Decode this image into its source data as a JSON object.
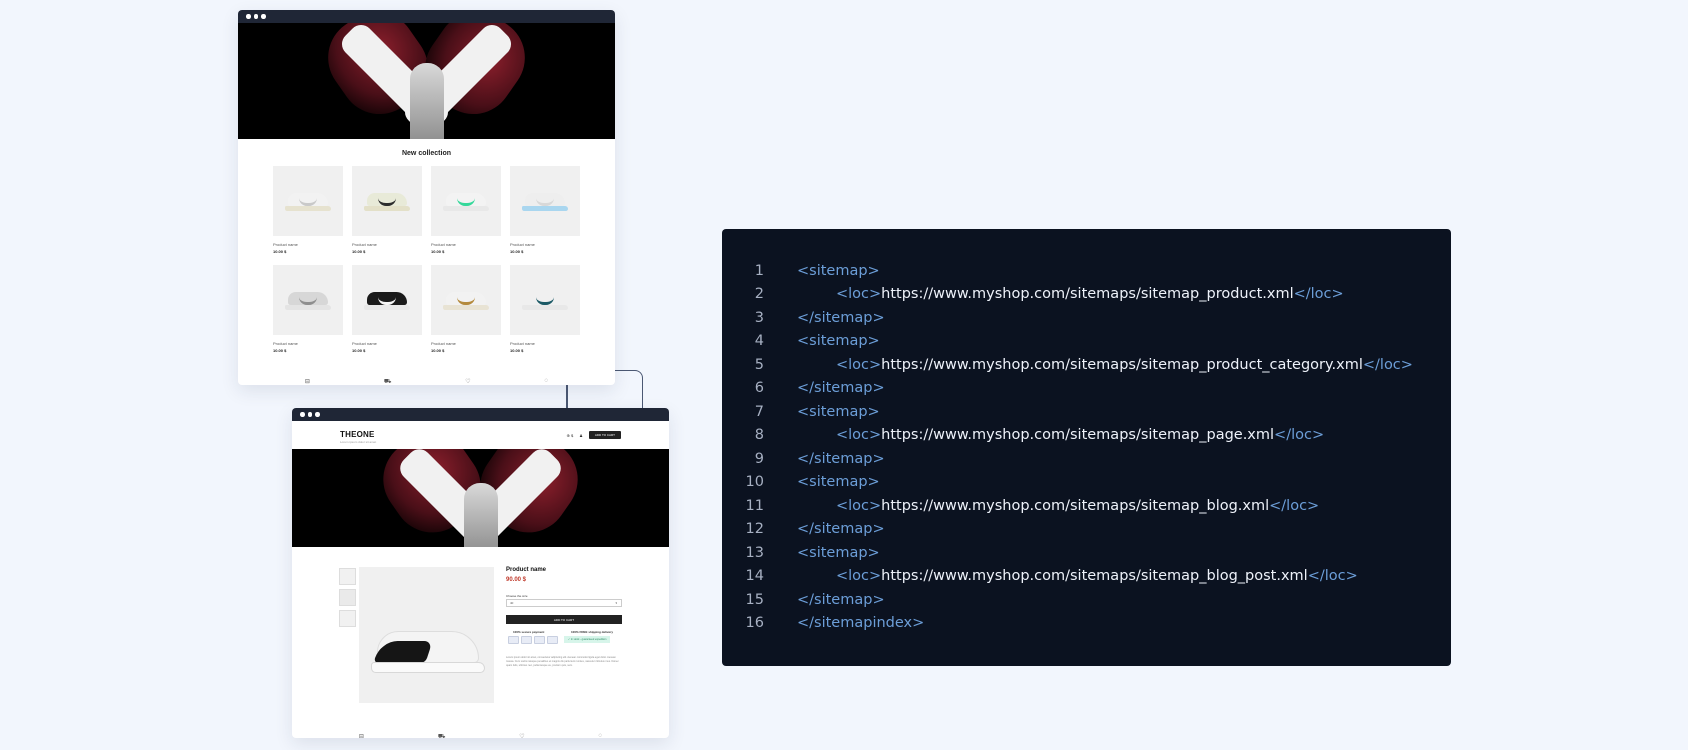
{
  "window1": {
    "section_title": "New collection",
    "products": [
      {
        "name": "Product name",
        "price": "10.00 $",
        "upper": "#f2f2f2",
        "swoosh": "#c9c9c9",
        "sole": "#e6e2cf"
      },
      {
        "name": "Product name",
        "price": "10.00 $",
        "upper": "#e8ead8",
        "swoosh": "#2c2c2c",
        "sole": "#e3e0c8"
      },
      {
        "name": "Product name",
        "price": "10.00 $",
        "upper": "#f3f3f3",
        "swoosh": "#35d89a",
        "sole": "#e8e8e8"
      },
      {
        "name": "Product name",
        "price": "10.00 $",
        "upper": "#eeeeee",
        "swoosh": "#d8d8d8",
        "sole": "#a9d6ef"
      },
      {
        "name": "Product name",
        "price": "10.00 $",
        "upper": "#d7d7d7",
        "swoosh": "#8e8e8e",
        "sole": "#e4e4e4"
      },
      {
        "name": "Product name",
        "price": "10.00 $",
        "upper": "#1a1a1a",
        "swoosh": "#f4f4f4",
        "sole": "#e8e8e8"
      },
      {
        "name": "Product name",
        "price": "10.00 $",
        "upper": "#f2f2f2",
        "swoosh": "#b48a3c",
        "sole": "#e8e3d4"
      },
      {
        "name": "Product name",
        "price": "10.00 $",
        "upper": "#f0f0f0",
        "swoosh": "#1c5a66",
        "sole": "#e8e8e8"
      }
    ],
    "footer_icons": [
      "⊟",
      "⛟",
      "♡",
      "◌"
    ]
  },
  "window2": {
    "brand": "THEONE",
    "brand_tagline": "Lorem ipsum dolor sit amet",
    "nav_currency": "⊕ $",
    "nav_user_icon": "♟",
    "nav_cart_button": "ADD TO CART",
    "product_name": "Product name",
    "product_price": "90.00 $",
    "size_label": "Choose the size",
    "size_value": "40",
    "add_to_cart": "ADD TO CART",
    "secure_label": "100% secure payment",
    "shipping_label": "100% FREE shipping delivery",
    "shipping_badge": "✓ In stock - guaranteed expedition",
    "description": "Lorem ipsum dolor sit amet, consectetur adipiscing elit. Aenean commodo ligula eget dolor. Aenean massa. Cum sociis natoque penatibus et magnis dis parturient montes, nascetur ridiculus mus. Donec quam felis, ultricies nec, pellentesque eu, pretium quis, sem.",
    "footer_icons": [
      "⊟",
      "⛟",
      "♡",
      "◌"
    ]
  },
  "code": {
    "lines": [
      {
        "num": "1",
        "open": "<sitemap>",
        "text": "",
        "close": "",
        "indent": 1
      },
      {
        "num": "2",
        "open": "<loc>",
        "text": "https://www.myshop.com/sitemaps/sitemap_product.xml",
        "close": "</loc>",
        "indent": 2
      },
      {
        "num": "3",
        "open": "</sitemap>",
        "text": "",
        "close": "",
        "indent": 1
      },
      {
        "num": "4",
        "open": "<sitemap>",
        "text": "",
        "close": "",
        "indent": 1
      },
      {
        "num": "5",
        "open": "<loc>",
        "text": "https://www.myshop.com/sitemaps/sitemap_product_category.xml",
        "close": "</loc>",
        "indent": 2
      },
      {
        "num": "6",
        "open": "</sitemap>",
        "text": "",
        "close": "",
        "indent": 1
      },
      {
        "num": "7",
        "open": "<sitemap>",
        "text": "",
        "close": "",
        "indent": 1
      },
      {
        "num": "8",
        "open": "<loc>",
        "text": "https://www.myshop.com/sitemaps/sitemap_page.xml",
        "close": "</loc>",
        "indent": 2
      },
      {
        "num": "9",
        "open": "</sitemap>",
        "text": "",
        "close": "",
        "indent": 1
      },
      {
        "num": "10",
        "open": "<sitemap>",
        "text": "",
        "close": "",
        "indent": 1
      },
      {
        "num": "11",
        "open": "<loc>",
        "text": "https://www.myshop.com/sitemaps/sitemap_blog.xml",
        "close": "</loc>",
        "indent": 2
      },
      {
        "num": "12",
        "open": "</sitemap>",
        "text": "",
        "close": "",
        "indent": 1
      },
      {
        "num": "13",
        "open": "<sitemap>",
        "text": "",
        "close": "",
        "indent": 1
      },
      {
        "num": "14",
        "open": "<loc>",
        "text": "https://www.myshop.com/sitemaps/sitemap_blog_post.xml",
        "close": "</loc>",
        "indent": 2
      },
      {
        "num": "15",
        "open": "</sitemap>",
        "text": "",
        "close": "",
        "indent": 1
      },
      {
        "num": "16",
        "open": "</sitemapindex>",
        "text": "",
        "close": "",
        "indent": 1
      }
    ],
    "colors": {
      "background": "#0b1220",
      "tag": "#6c9ed8",
      "text": "#eef2fa",
      "line_number": "#a7b0c2"
    }
  },
  "colors": {
    "page_background": "#f2f6fd",
    "window_bar": "#1f2636",
    "connector": "#4b5873",
    "price_red": "#c0392b"
  }
}
